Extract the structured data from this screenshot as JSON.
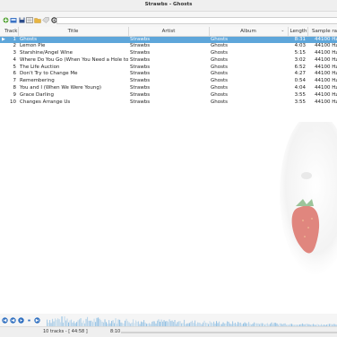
{
  "window": {
    "title": "Strawbs - Ghosts"
  },
  "toolbar": {
    "buttons": [
      "add-icon",
      "open-icon",
      "save-icon",
      "playlist-icon",
      "folder-icon",
      "tag-icon",
      "settings-icon"
    ],
    "search_value": ""
  },
  "table": {
    "headers": {
      "track": "Track",
      "title": "Title",
      "artist": "Artist",
      "album": "Album",
      "length": "Length",
      "rate": "Sample rate"
    },
    "rows": [
      {
        "track": "1",
        "title": "Ghosts",
        "artist": "Strawbs",
        "album": "Ghosts",
        "length": "8:31",
        "rate": "44100 Hz",
        "selected": true
      },
      {
        "track": "2",
        "title": "Lemon Pie",
        "artist": "Strawbs",
        "album": "Ghosts",
        "length": "4:03",
        "rate": "44100 Hz"
      },
      {
        "track": "3",
        "title": "Starshine/Angel Wine",
        "artist": "Strawbs",
        "album": "Ghosts",
        "length": "5:15",
        "rate": "44100 Hz"
      },
      {
        "track": "4",
        "title": "Where Do You Go (When You Need a Hole to Cra...",
        "artist": "Strawbs",
        "album": "Ghosts",
        "length": "3:02",
        "rate": "44100 Hz"
      },
      {
        "track": "5",
        "title": "The Life Auction",
        "artist": "Strawbs",
        "album": "Ghosts",
        "length": "6:52",
        "rate": "44100 Hz"
      },
      {
        "track": "6",
        "title": "Don't Try to Change Me",
        "artist": "Strawbs",
        "album": "Ghosts",
        "length": "4:27",
        "rate": "44100 Hz"
      },
      {
        "track": "7",
        "title": "Remembering",
        "artist": "Strawbs",
        "album": "Ghosts",
        "length": "0:54",
        "rate": "44100 Hz"
      },
      {
        "track": "8",
        "title": "You and I (When We Were Young)",
        "artist": "Strawbs",
        "album": "Ghosts",
        "length": "4:04",
        "rate": "44100 Hz"
      },
      {
        "track": "9",
        "title": "Grace Darling",
        "artist": "Strawbs",
        "album": "Ghosts",
        "length": "3:55",
        "rate": "44100 Hz"
      },
      {
        "track": "10",
        "title": "Changes Arrange Us",
        "artist": "Strawbs",
        "album": "Ghosts",
        "length": "3:55",
        "rate": "44100 Hz"
      }
    ]
  },
  "controls": [
    "prev-icon",
    "stop-icon",
    "play-icon",
    "pause-icon",
    "next-icon"
  ],
  "status": {
    "tracks": "10 tracks - [ 44:58 ]",
    "position": "8:10",
    "progress_fraction": 0.0
  },
  "colors": {
    "selection": "#5ea6da",
    "visualizer": "#7fb6df"
  }
}
